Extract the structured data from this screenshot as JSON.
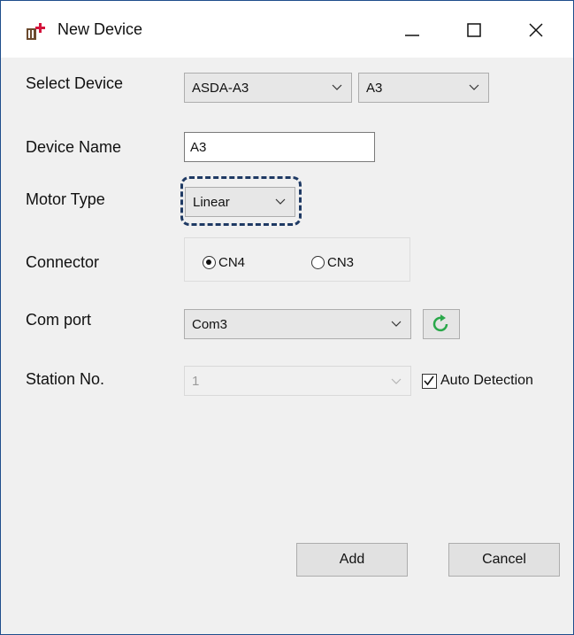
{
  "window": {
    "title": "New Device",
    "controls": {
      "minimize": "minimize-icon",
      "maximize": "maximize-icon",
      "close": "close-icon"
    }
  },
  "form": {
    "select_device": {
      "label": "Select Device",
      "series": "ASDA-A3",
      "model": "A3"
    },
    "device_name": {
      "label": "Device Name",
      "value": "A3"
    },
    "motor_type": {
      "label": "Motor Type",
      "value": "Linear"
    },
    "connector": {
      "label": "Connector",
      "options": [
        "CN4",
        "CN3"
      ],
      "selected": "CN4"
    },
    "com_port": {
      "label": "Com port",
      "value": "Com3",
      "refresh_icon": "refresh-icon"
    },
    "station_no": {
      "label": "Station No.",
      "value": "1",
      "auto_detection_label": "Auto Detection",
      "auto_detection_checked": true
    }
  },
  "buttons": {
    "add": "Add",
    "cancel": "Cancel"
  },
  "colors": {
    "window_border": "#1f4e8c",
    "highlight_dash": "#1f3a64",
    "refresh_green": "#2aa84a",
    "app_icon_red": "#d4143c"
  }
}
